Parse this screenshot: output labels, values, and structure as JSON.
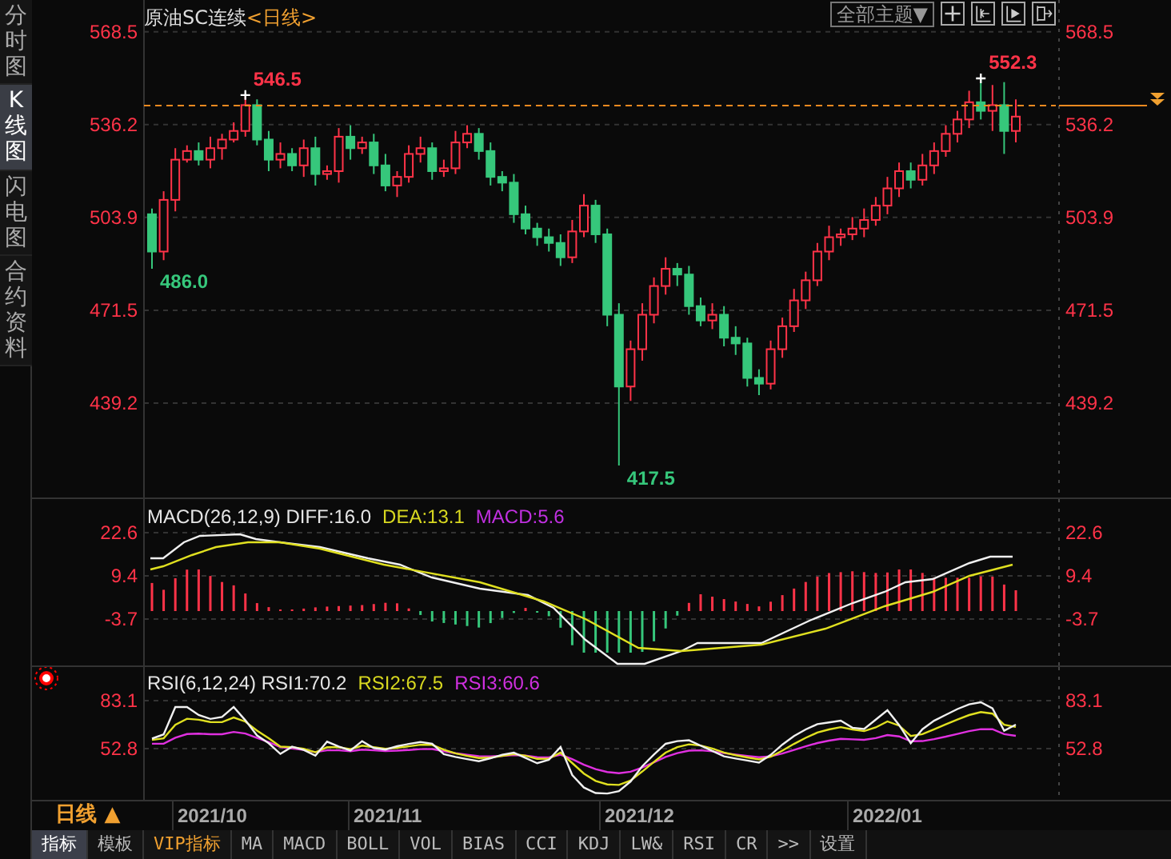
{
  "sidebar_tabs": [
    {
      "label": "分时图",
      "selected": false
    },
    {
      "label": "K线图",
      "selected": true
    },
    {
      "label": "闪电图",
      "selected": false
    },
    {
      "label": "合约资料",
      "selected": false
    }
  ],
  "chart_title": {
    "name": "原油SC连续",
    "period": "<日线>"
  },
  "theme_dropdown": {
    "label": "全部主题▼"
  },
  "price_chart": {
    "chart_data": {
      "type": "candlestick",
      "ylim": [
        405.8,
        579.6
      ],
      "grid": true,
      "yticks": [
        568.5,
        536.2,
        503.9,
        471.5,
        439.2
      ],
      "ohlc": [
        [
          505,
          507,
          486,
          492
        ],
        [
          492,
          513,
          489,
          510
        ],
        [
          510,
          528,
          506,
          524
        ],
        [
          524,
          529,
          523,
          527
        ],
        [
          527,
          530,
          522,
          524
        ],
        [
          524,
          532,
          521,
          528
        ],
        [
          528,
          533,
          524,
          531
        ],
        [
          531,
          537,
          530,
          534
        ],
        [
          534,
          546.5,
          532,
          543
        ],
        [
          543,
          545,
          529,
          531
        ],
        [
          531,
          534,
          520,
          524
        ],
        [
          524,
          530,
          521,
          526
        ],
        [
          526,
          528,
          520,
          522
        ],
        [
          522,
          531,
          518,
          528
        ],
        [
          528,
          532,
          515,
          519
        ],
        [
          519,
          522,
          517,
          520
        ],
        [
          520,
          535,
          516,
          532
        ],
        [
          532,
          536,
          524,
          528
        ],
        [
          528,
          532,
          526,
          530
        ],
        [
          530,
          533,
          519,
          522
        ],
        [
          522,
          526,
          513,
          515
        ],
        [
          515,
          520,
          511,
          518
        ],
        [
          518,
          529,
          516,
          526
        ],
        [
          526,
          532,
          523,
          528
        ],
        [
          528,
          530,
          517,
          520
        ],
        [
          520,
          524,
          518,
          521
        ],
        [
          521,
          534,
          519,
          530
        ],
        [
          530,
          536,
          528,
          533
        ],
        [
          533,
          535,
          524,
          527
        ],
        [
          527,
          530,
          515,
          518
        ],
        [
          518,
          520,
          513,
          516
        ],
        [
          516,
          519,
          502,
          505
        ],
        [
          505,
          508,
          498,
          500
        ],
        [
          500,
          502,
          494,
          497
        ],
        [
          497,
          500,
          492,
          495
        ],
        [
          495,
          498,
          487,
          490
        ],
        [
          490,
          503,
          488,
          499
        ],
        [
          499,
          512,
          497,
          508
        ],
        [
          508,
          510,
          495,
          498
        ],
        [
          498,
          500,
          466,
          470
        ],
        [
          470,
          474,
          417.5,
          445
        ],
        [
          445,
          461,
          440,
          458
        ],
        [
          458,
          474,
          454,
          470
        ],
        [
          470,
          483,
          467,
          480
        ],
        [
          480,
          490,
          477,
          486
        ],
        [
          486,
          488,
          480,
          484
        ],
        [
          484,
          487,
          470,
          473
        ],
        [
          473,
          476,
          466,
          468
        ],
        [
          468,
          474,
          465,
          470
        ],
        [
          470,
          473,
          459,
          462
        ],
        [
          462,
          466,
          456,
          460
        ],
        [
          460,
          462,
          445,
          448
        ],
        [
          448,
          451,
          442,
          446
        ],
        [
          446,
          461,
          444,
          458
        ],
        [
          458,
          469,
          455,
          466
        ],
        [
          466,
          479,
          464,
          475
        ],
        [
          475,
          485,
          472,
          482
        ],
        [
          482,
          495,
          480,
          492
        ],
        [
          492,
          501,
          489,
          497
        ],
        [
          497,
          500,
          494,
          498
        ],
        [
          498,
          504,
          496,
          500
        ],
        [
          500,
          507,
          497,
          503
        ],
        [
          503,
          511,
          501,
          508
        ],
        [
          508,
          518,
          505,
          514
        ],
        [
          514,
          523,
          511,
          520
        ],
        [
          520,
          523,
          514,
          517
        ],
        [
          517,
          526,
          515,
          522
        ],
        [
          522,
          530,
          519,
          527
        ],
        [
          527,
          536,
          525,
          533
        ],
        [
          533,
          541,
          530,
          538
        ],
        [
          538,
          548,
          535,
          544
        ],
        [
          544,
          552.3,
          538,
          541
        ],
        [
          541,
          550,
          534,
          543
        ],
        [
          543,
          551,
          526,
          534
        ],
        [
          534,
          545,
          530,
          539
        ]
      ]
    }
  },
  "price_axis": {
    "left_labels": [
      "568.5",
      "536.2",
      "503.9",
      "471.5",
      "439.2"
    ],
    "right_labels": [
      "568.5",
      "536.2",
      "503.9",
      "471.5",
      "439.2"
    ]
  },
  "price_annotations": [
    {
      "text": "546.5",
      "kind": "high"
    },
    {
      "text": "552.3",
      "kind": "high"
    },
    {
      "text": "486.0",
      "kind": "low"
    },
    {
      "text": "417.5",
      "kind": "low"
    }
  ],
  "macd_panel": {
    "legend": [
      {
        "text": "MACD(26,12,9) DIFF:16.0",
        "color": "#e6e6e6"
      },
      {
        "text": "DEA:13.1",
        "color": "#d8d820"
      },
      {
        "text": "MACD:5.6",
        "color": "#c030e0"
      }
    ],
    "left_labels": [
      "22.6",
      "9.4",
      "-3.7"
    ],
    "right_labels": [
      "22.6",
      "9.4",
      "-3.7"
    ]
  },
  "rsi_panel": {
    "legend": [
      {
        "text": "RSI(6,12,24) RSI1:70.2",
        "color": "#e6e6e6"
      },
      {
        "text": "RSI2:67.5",
        "color": "#d8d820"
      },
      {
        "text": "RSI3:60.6",
        "color": "#d030e0"
      }
    ],
    "left_labels": [
      "83.1",
      "52.8"
    ],
    "right_labels": [
      "83.1",
      "52.8"
    ]
  },
  "period_button": {
    "label": "日线 ▲"
  },
  "date_axis": [
    "2021/10",
    "2021/11",
    "2021/12",
    "2022/01"
  ],
  "bottom_tabs": [
    {
      "label": "指标",
      "selected": true,
      "kind": "normal"
    },
    {
      "label": "模板",
      "selected": false,
      "kind": "normal"
    },
    {
      "label": "VIP指标",
      "selected": false,
      "kind": "vip"
    },
    {
      "label": "MA",
      "selected": false,
      "kind": "normal"
    },
    {
      "label": "MACD",
      "selected": false,
      "kind": "normal"
    },
    {
      "label": "BOLL",
      "selected": false,
      "kind": "normal"
    },
    {
      "label": "VOL",
      "selected": false,
      "kind": "normal"
    },
    {
      "label": "BIAS",
      "selected": false,
      "kind": "normal"
    },
    {
      "label": "CCI",
      "selected": false,
      "kind": "normal"
    },
    {
      "label": "KDJ",
      "selected": false,
      "kind": "normal"
    },
    {
      "label": "LW&",
      "selected": false,
      "kind": "normal"
    },
    {
      "label": "RSI",
      "selected": false,
      "kind": "normal"
    },
    {
      "label": "CR",
      "selected": false,
      "kind": "normal"
    },
    {
      "label": ">>",
      "selected": false,
      "kind": "normal"
    },
    {
      "label": "设置",
      "selected": false,
      "kind": "normal"
    }
  ]
}
